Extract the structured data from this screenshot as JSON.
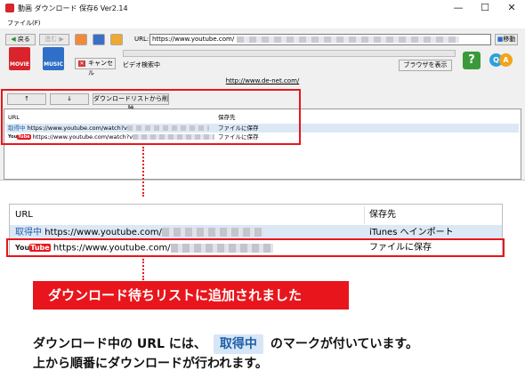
{
  "app": {
    "title": "動画 ダウンロード 保存6 Ver2.14",
    "window_controls": {
      "minimize": "—",
      "maximize": "☐",
      "close": "✕"
    },
    "menu": [
      "ファイル(F)"
    ]
  },
  "toolbar": {
    "back_label": "戻る",
    "forward_label": "進む",
    "url_label": "URL:",
    "url_value": "https://www.youtube.com/",
    "go_label": "移動"
  },
  "actions": {
    "movie_label": "MOVIE",
    "music_label": "MUSIC",
    "cancel_label": "キャンセル",
    "status_text": "ビデオ検索中",
    "browser_label": "ブラウザを表示",
    "help_label": "?",
    "qa_q": "Q",
    "qa_a": "A",
    "site_link": "http://www.de-net.com/"
  },
  "queue_controls": {
    "up_label": "↑",
    "down_label": "↓",
    "delete_label": "ダウンロードリストから削除"
  },
  "small_list": {
    "headers": {
      "url": "URL",
      "dest": "保存先"
    },
    "rows": [
      {
        "tag": "取得中",
        "url": "https://www.youtube.com/watch?v",
        "dest": "ファイルに保存"
      },
      {
        "tag": "YouTube",
        "url": "https://www.youtube.com/watch?v",
        "dest": "ファイルに保存"
      }
    ]
  },
  "zoom_list": {
    "headers": {
      "url": "URL",
      "dest": "保存先"
    },
    "rows": [
      {
        "tag": "取得中",
        "url": "https://www.youtube.com/",
        "dest": "iTunes へインポート"
      },
      {
        "tag_you": "You",
        "tag_tube": "Tube",
        "url": "https://www.youtube.com/",
        "dest": "ファイルに保存"
      }
    ]
  },
  "callout": "ダウンロード待ちリストに追加されました",
  "note": {
    "line1_pre": "ダウンロード中の URL には、",
    "badge": "取得中",
    "line1_post": "のマークが付いています。",
    "line2": "上から順番にダウンロードが行われます。"
  },
  "colors": {
    "highlight_red": "#e8161c",
    "selected_row": "#dce8f6",
    "badge_bg": "#d6e6f7"
  }
}
